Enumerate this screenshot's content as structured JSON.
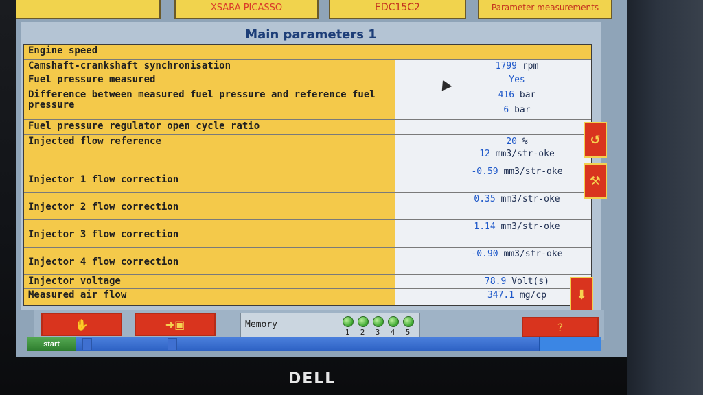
{
  "tabs": {
    "vehicle": "XSARA PICASSO",
    "ecu": "EDC15C2",
    "section": "Parameter measurements"
  },
  "page": {
    "title": "Main parameters 1"
  },
  "table": {
    "rows": [
      {
        "label": "Engine speed",
        "value": "",
        "unit": ""
      },
      {
        "label": "Camshaft-crankshaft synchronisation",
        "value": "1799",
        "unit": "rpm"
      },
      {
        "label": "Fuel pressure measured",
        "value": "Yes",
        "unit": ""
      },
      {
        "label": "Difference between measured fuel pressure and reference fuel pressure",
        "value": "416",
        "unit": "bar"
      },
      {
        "label": "",
        "value": "6",
        "unit": "bar"
      },
      {
        "label": "Fuel pressure regulator open cycle ratio",
        "value": "",
        "unit": ""
      },
      {
        "label": "Injected flow reference",
        "value": "20",
        "unit": "%"
      },
      {
        "label": "",
        "value": "12",
        "unit": "mm3/str-oke"
      },
      {
        "label": "Injector 1 flow correction",
        "value": "-0.59",
        "unit": "mm3/str-oke"
      },
      {
        "label": "Injector 2 flow correction",
        "value": "0.35",
        "unit": "mm3/str-oke"
      },
      {
        "label": "Injector 3 flow correction",
        "value": "1.14",
        "unit": "mm3/str-oke"
      },
      {
        "label": "Injector 4 flow correction",
        "value": "-0.90",
        "unit": "mm3/str-oke"
      },
      {
        "label": "Injector voltage",
        "value": "78.9",
        "unit": "Volt(s)"
      },
      {
        "label": "Measured air flow",
        "value": "347.1",
        "unit": "mg/cp"
      }
    ]
  },
  "bottom": {
    "memory_label": "Memory",
    "memory_slots": [
      "1",
      "2",
      "3",
      "4",
      "5"
    ],
    "help_label": "?"
  },
  "taskbar": {
    "start_label": "start",
    "items": [
      "",
      ""
    ],
    "tray_text": ""
  },
  "brand": "DELL"
}
